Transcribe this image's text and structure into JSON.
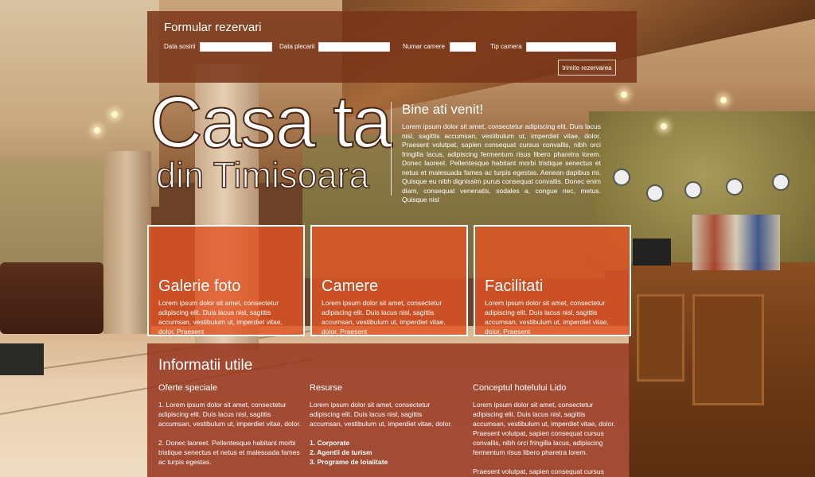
{
  "reservation": {
    "title": "Formular rezervari",
    "fields": [
      {
        "label": "Data sosirii",
        "value": ""
      },
      {
        "label": "Data plecarii",
        "value": ""
      },
      {
        "label": "Numar camere",
        "value": ""
      },
      {
        "label": "Tip camera",
        "value": ""
      }
    ],
    "submit_label": "trimite rezervarea"
  },
  "hero": {
    "title": "Casa ta",
    "subtitle": "din Timisoara"
  },
  "welcome": {
    "title": "Bine ati venit!",
    "text": "Lorem ipsum dolor sit amet, consectetur adipiscing elit. Duis lacus nisl, sagittis accumsan, vestibulum ut, imperdiet vitae, dolor. Praesent volutpat, sapien consequat cursus convallis, nibh orci fringilla lacus, adipiscing fermentum risus libero pharetra lorem. Donec laoreet. Pellentesque habitant morbi tristique senectus et netus et malesuada fames ac turpis egestas. Aenean dapibus mi. Quisque eu nibh dignissim purus consequat convallis. Donec enim diam, consequat venenatis, sodales a, congue nec, metus. Quisque nisl"
  },
  "features": [
    {
      "title": "Galerie foto",
      "text": "Lorem ipsum dolor sit amet, consectetur adipiscing elit. Duis lacus nisl, sagittis accumsan, vestibulum ut, imperdiet vitae, dolor. Praesent"
    },
    {
      "title": "Camere",
      "text": "Lorem ipsum dolor sit amet, consectetur adipiscing elit. Duis lacus nisl, sagittis accumsan, vestibulum ut, imperdiet vitae, dolor. Praesent"
    },
    {
      "title": "Facilitati",
      "text": "Lorem ipsum dolor sit amet, consectetur adipiscing elit. Duis lacus nisl, sagittis accumsan, vestibulum ut, imperdiet vitae, dolor. Praesent"
    }
  ],
  "info": {
    "title": "Informatii utile",
    "columns": [
      {
        "title": "Oferte speciale",
        "paragraphs": [
          "1. Lorem ipsum dolor sit amet, consectetur adipiscing elit. Duis lacus nisl, sagittis accumsan, vestibulum ut, imperdiet vitae, dolor.",
          "2. Donec laoreet. Pellentesque habitant morbi tristique senectus et netus et malesuada fames ac turpis egestas."
        ]
      },
      {
        "title": "Resurse",
        "paragraphs": [
          "Lorem ipsum dolor sit amet, consectetur adipiscing elit. Duis lacus nisl, sagittis accumsan, vestibulum ut, imperdiet vitae, dolor."
        ],
        "links": [
          "1. Corporate",
          "2. Agentii de turism",
          "3. Programe de loialitate"
        ]
      },
      {
        "title": "Conceptul hotelului Lido",
        "paragraphs": [
          "Lorem ipsum dolor sit amet, consectetur adipiscing elit. Duis lacus nisl, sagittis accumsan, vestibulum ut, imperdiet vitae, dolor. Praesent volutpat, sapien consequat cursus convallis, nibh orci fringilla lacus, adipiscing fermentum risus libero pharetra lorem.",
          "Praesent volutpat, sapien consequat cursus convallis, nibh orci fringilla lacus, adipiscing"
        ]
      }
    ]
  },
  "colors": {
    "form_bg": "#78341a",
    "feature_bg": "#e25424",
    "info_bg": "#96341e"
  }
}
